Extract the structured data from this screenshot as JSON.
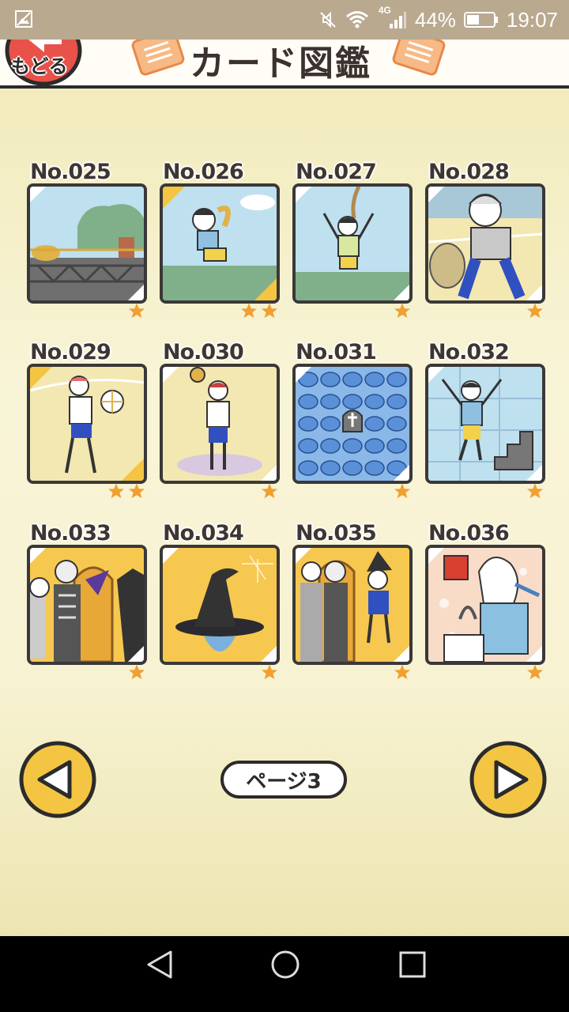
{
  "status_bar": {
    "network": "4G",
    "battery": "44%",
    "time": "19:07"
  },
  "header": {
    "back_label": "もどる",
    "title": "カード図鑑"
  },
  "cards": [
    {
      "number": "No.025",
      "stars": 1
    },
    {
      "number": "No.026",
      "stars": 2
    },
    {
      "number": "No.027",
      "stars": 1
    },
    {
      "number": "No.028",
      "stars": 1
    },
    {
      "number": "No.029",
      "stars": 2
    },
    {
      "number": "No.030",
      "stars": 1
    },
    {
      "number": "No.031",
      "stars": 1
    },
    {
      "number": "No.032",
      "stars": 1
    },
    {
      "number": "No.033",
      "stars": 1
    },
    {
      "number": "No.034",
      "stars": 1
    },
    {
      "number": "No.035",
      "stars": 1
    },
    {
      "number": "No.036",
      "stars": 1
    }
  ],
  "pagination": {
    "page_label": "ページ3"
  },
  "colors": {
    "accent_gold": "#f4c542",
    "star": "#f0a030",
    "outline": "#2e2a29"
  }
}
